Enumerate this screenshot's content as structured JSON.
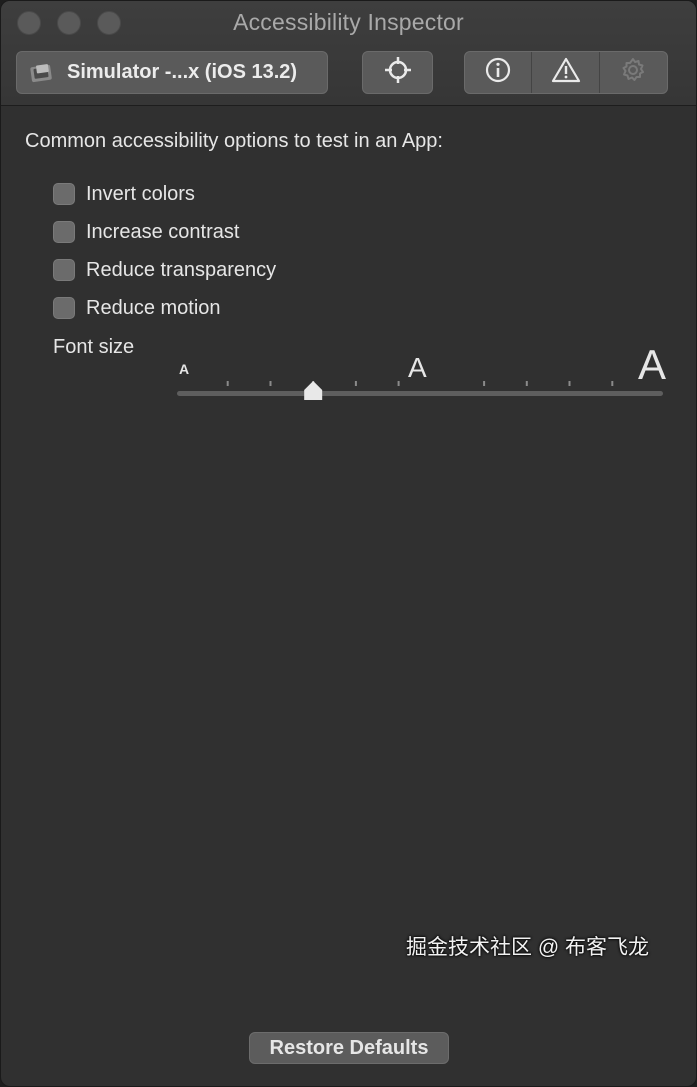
{
  "window": {
    "title": "Accessibility Inspector"
  },
  "toolbar": {
    "device_label": "Simulator -...x (iOS 13.2)",
    "target_icon": "crosshair-icon",
    "inspect_icon": "info-icon",
    "audit_icon": "warning-icon",
    "settings_icon": "gear-icon"
  },
  "content": {
    "heading": "Common accessibility options to test in an App:",
    "options": [
      {
        "label": "Invert colors",
        "checked": false
      },
      {
        "label": "Increase contrast",
        "checked": false
      },
      {
        "label": "Reduce transparency",
        "checked": false
      },
      {
        "label": "Reduce motion",
        "checked": false
      }
    ],
    "font_size": {
      "label": "Font size",
      "small_glyph": "A",
      "medium_glyph": "A",
      "large_glyph": "A",
      "tick_count": 12,
      "selected_index": 3
    },
    "restore_button": "Restore Defaults"
  },
  "watermark": "掘金技术社区 @ 布客飞龙",
  "colors": {
    "window_bg": "#303030",
    "control_bg": "#5a5a5a",
    "text": "#e6e6e6"
  }
}
